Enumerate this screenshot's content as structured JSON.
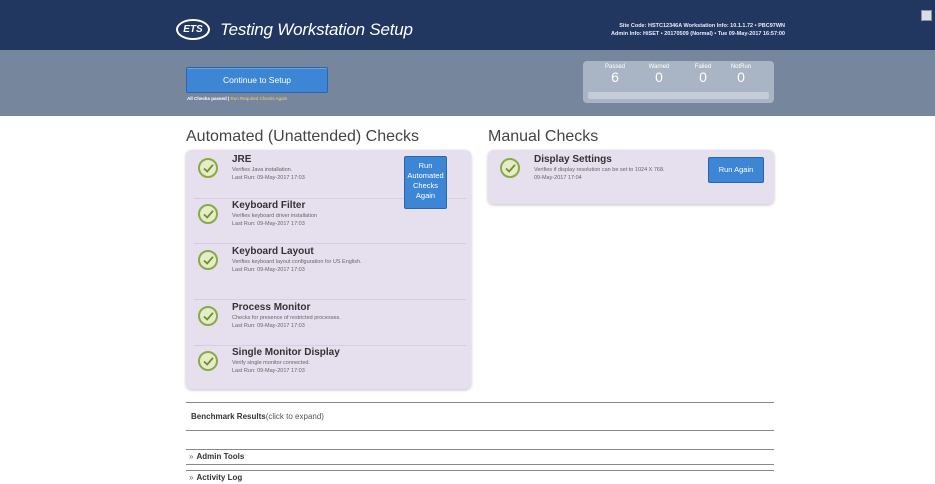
{
  "header": {
    "logo_text": "ETS",
    "title": "Testing Workstation Setup",
    "site_line": "Site Code: HSTC12346A  Workstation Info: 10.1.1.72  •  PBC97WN",
    "admin_line": "Admin Info: HiSET  •  20170509 (Normal)  •  Tue 09-May-2017 16:57:00"
  },
  "status": {
    "continue_label": "Continue to Setup",
    "all_passed_text": "All Checks passed |",
    "rerun_link": "Run Required Checks Again",
    "counts": [
      {
        "label": "Passed",
        "value": "6"
      },
      {
        "label": "Warned",
        "value": "0"
      },
      {
        "label": "Failed",
        "value": "0"
      },
      {
        "label": "NotRun",
        "value": "0"
      }
    ]
  },
  "automated": {
    "title": "Automated (Unattended) Checks",
    "run_label": "Run Automated Checks Again",
    "checks": [
      {
        "name": "JRE",
        "desc": "Verifies Java installation.",
        "last_run": "Last Run: 09-May-2017 17:03"
      },
      {
        "name": "Keyboard Filter",
        "desc": "Verifies keyboard driver installation",
        "last_run": "Last Run: 09-May-2017 17:03"
      },
      {
        "name": "Keyboard Layout",
        "desc": "Verifies keyboard layout configuration for US English.",
        "last_run": "Last Run: 09-May-2017 17:03"
      },
      {
        "name": "Process Monitor",
        "desc": "Checks for presence of restricted processes.",
        "last_run": "Last Run: 09-May-2017 17:03"
      },
      {
        "name": "Single Monitor Display",
        "desc": "Verify single monitor connected.",
        "last_run": "Last Run: 09-May-2017 17:03"
      }
    ]
  },
  "manual": {
    "title": "Manual Checks",
    "run_label": "Run Again",
    "checks": [
      {
        "name": "Display Settings",
        "desc": "Verifies if display resolution can be set to 1024 X 768.",
        "last_run": "09-May-2017 17:04"
      }
    ]
  },
  "sections": {
    "benchmark_title": "Benchmark Results",
    "benchmark_hint": "(click to expand)",
    "admin_tools": "Admin Tools",
    "activity_log": "Activity Log"
  },
  "colors": {
    "header_bg": "#213760",
    "band_bg": "#76879d",
    "button_blue": "#3d86d6",
    "panel_bg": "#e6dfee",
    "check_green": "#8aa94a"
  }
}
